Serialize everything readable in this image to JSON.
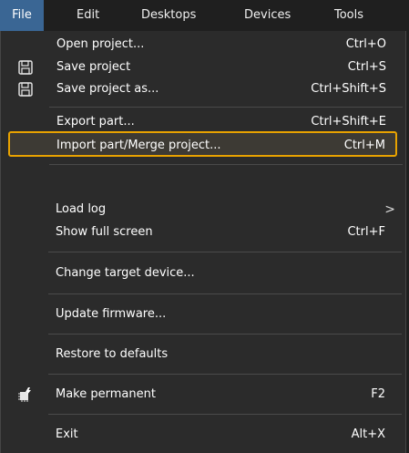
{
  "menubar": {
    "items": [
      {
        "label": "File",
        "active": true
      },
      {
        "label": "Edit"
      },
      {
        "label": "Desktops"
      },
      {
        "label": "Devices"
      },
      {
        "label": "Tools"
      }
    ]
  },
  "menu": {
    "items": [
      {
        "label": "Open project...",
        "shortcut": "Ctrl+O"
      },
      {
        "label": "Save project",
        "shortcut": "Ctrl+S",
        "icon": "save-icon"
      },
      {
        "label": "Save project as...",
        "shortcut": "Ctrl+Shift+S",
        "icon": "save-as-icon"
      },
      {
        "label": "Export part...",
        "shortcut": "Ctrl+Shift+E"
      },
      {
        "label": "Import part/Merge project...",
        "shortcut": "Ctrl+M",
        "highlighted": true
      },
      {
        "label": "Load log",
        "submenu_arrow": ">"
      },
      {
        "label": "Show full screen",
        "shortcut": "Ctrl+F"
      },
      {
        "label": "Change target device..."
      },
      {
        "label": "Update firmware..."
      },
      {
        "label": "Restore to defaults"
      },
      {
        "label": "Make permanent",
        "shortcut": "F2",
        "icon": "chip-flash-icon"
      },
      {
        "label": "Exit",
        "shortcut": "Alt+X"
      }
    ]
  },
  "colors": {
    "background": "#2b2b2b",
    "menubar_active": "#3a6694",
    "highlight_border": "#e8a200",
    "text": "#ffffff"
  }
}
